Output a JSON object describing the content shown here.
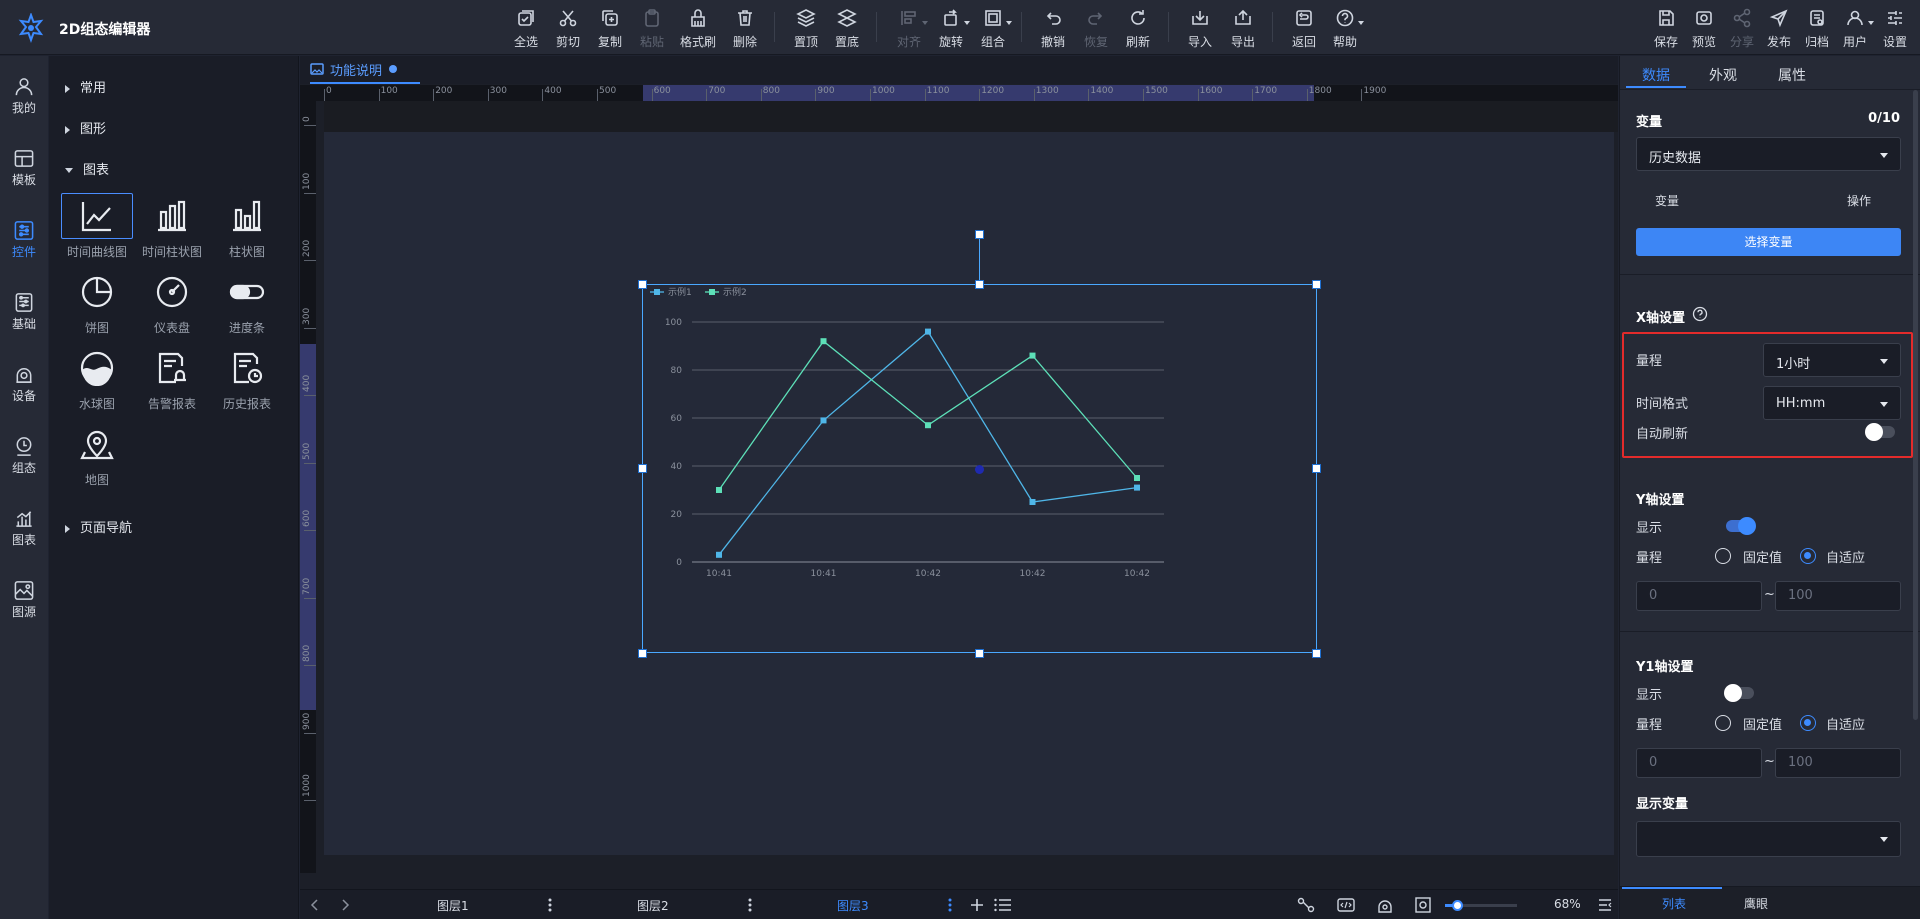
{
  "app": {
    "title": "2D组态编辑器"
  },
  "toolbar": {
    "items": [
      {
        "label": "全选",
        "icon": "select-all-icon"
      },
      {
        "label": "剪切",
        "icon": "scissors-icon"
      },
      {
        "label": "复制",
        "icon": "copy-icon"
      },
      {
        "label": "粘贴",
        "icon": "paste-icon"
      },
      {
        "label": "格式刷",
        "icon": "format-brush-icon"
      },
      {
        "label": "删除",
        "icon": "trash-icon"
      },
      {
        "label": "置顶",
        "icon": "bring-to-front-icon"
      },
      {
        "label": "置底",
        "icon": "send-to-back-icon"
      },
      {
        "label": "对齐",
        "icon": "align-icon"
      },
      {
        "label": "旋转",
        "icon": "rotate-icon"
      },
      {
        "label": "组合",
        "icon": "group-icon"
      },
      {
        "label": "撤销",
        "icon": "undo-icon"
      },
      {
        "label": "恢复",
        "icon": "redo-icon"
      },
      {
        "label": "刷新",
        "icon": "refresh-icon"
      },
      {
        "label": "导入",
        "icon": "import-icon"
      },
      {
        "label": "导出",
        "icon": "export-icon"
      },
      {
        "label": "返回",
        "icon": "back-icon"
      },
      {
        "label": "帮助",
        "icon": "help-icon"
      },
      {
        "label": "保存",
        "icon": "save-icon"
      },
      {
        "label": "预览",
        "icon": "preview-icon"
      },
      {
        "label": "分享",
        "icon": "share-icon"
      },
      {
        "label": "发布",
        "icon": "publish-icon"
      },
      {
        "label": "归档",
        "icon": "archive-icon"
      },
      {
        "label": "用户",
        "icon": "user-icon"
      },
      {
        "label": "设置",
        "icon": "settings-icon"
      }
    ]
  },
  "leftnav": {
    "items": [
      {
        "label": "我的",
        "icon": "my-icon"
      },
      {
        "label": "模板",
        "icon": "template-icon"
      },
      {
        "label": "控件",
        "icon": "widget-icon"
      },
      {
        "label": "基础",
        "icon": "basic-icon"
      },
      {
        "label": "设备",
        "icon": "device-icon"
      },
      {
        "label": "组态",
        "icon": "scada-icon"
      },
      {
        "label": "图表",
        "icon": "chart-icon"
      },
      {
        "label": "图源",
        "icon": "image-source-icon"
      }
    ]
  },
  "components": {
    "groups": [
      "常用",
      "图形",
      "图表",
      "页面导航"
    ],
    "chart_items": [
      {
        "label": "时间曲线图",
        "icon": "time-line-chart-icon"
      },
      {
        "label": "时间柱状图",
        "icon": "time-bar-chart-icon"
      },
      {
        "label": "柱状图",
        "icon": "bar-chart-icon"
      },
      {
        "label": "饼图",
        "icon": "pie-chart-icon"
      },
      {
        "label": "仪表盘",
        "icon": "gauge-icon"
      },
      {
        "label": "进度条",
        "icon": "progress-bar-icon"
      },
      {
        "label": "水球图",
        "icon": "liquid-fill-icon"
      },
      {
        "label": "告警报表",
        "icon": "alarm-report-icon"
      },
      {
        "label": "历史报表",
        "icon": "history-report-icon"
      },
      {
        "label": "地图",
        "icon": "map-icon"
      }
    ]
  },
  "canvas": {
    "tab": "功能说明",
    "ruler_h": [
      "0",
      "100",
      "200",
      "300",
      "400",
      "500",
      "600",
      "700",
      "800",
      "900",
      "1000",
      "1100",
      "1200",
      "1300",
      "1400",
      "1500",
      "1600",
      "1700",
      "1800",
      "1900"
    ],
    "ruler_v": [
      "0",
      "100",
      "200",
      "300",
      "400",
      "500",
      "600",
      "700",
      "800",
      "900",
      "1000"
    ],
    "layers": [
      "图层1",
      "图层2",
      "图层3"
    ],
    "zoom": "68%"
  },
  "chart_data": {
    "type": "line",
    "categories": [
      "10:41",
      "10:41",
      "10:42",
      "10:42",
      "10:42"
    ],
    "series": [
      {
        "name": "示例1",
        "values": [
          3,
          59,
          96,
          25,
          31
        ],
        "color": "#4fb6e8"
      },
      {
        "name": "示例2",
        "values": [
          30,
          92,
          57,
          86,
          35
        ],
        "color": "#5de0b8"
      }
    ],
    "yticks": [
      "0",
      "20",
      "40",
      "60",
      "80",
      "100"
    ],
    "ylim": [
      0,
      100
    ],
    "legend": "top-left",
    "grid": true
  },
  "rightpanel": {
    "tabs": [
      "数据",
      "外观",
      "属性"
    ],
    "variable": {
      "title": "变量",
      "count": "0/10",
      "source": "历史数据",
      "col_var": "变量",
      "col_op": "操作",
      "button": "选择变量"
    },
    "xaxis": {
      "title": "X轴设置",
      "range_label": "量程",
      "range_value": "1小时",
      "format_label": "时间格式",
      "format_value": "HH:mm",
      "auto_refresh": "自动刷新"
    },
    "yaxis": {
      "title": "Y轴设置",
      "show": "显示",
      "range": "量程",
      "fixed": "固定值",
      "adaptive": "自适应",
      "min_ph": "0",
      "max_ph": "100",
      "tilde": "~"
    },
    "y1axis": {
      "title": "Y1轴设置",
      "show": "显示",
      "range": "量程",
      "fixed": "固定值",
      "adaptive": "自适应",
      "min_ph": "0",
      "max_ph": "100",
      "tilde": "~"
    },
    "display_var": {
      "title": "显示变量"
    },
    "bottom_tabs": [
      "列表",
      "鹰眼"
    ]
  },
  "colors": {
    "accent": "#3d8bff",
    "highlight": "#e32b2b"
  }
}
